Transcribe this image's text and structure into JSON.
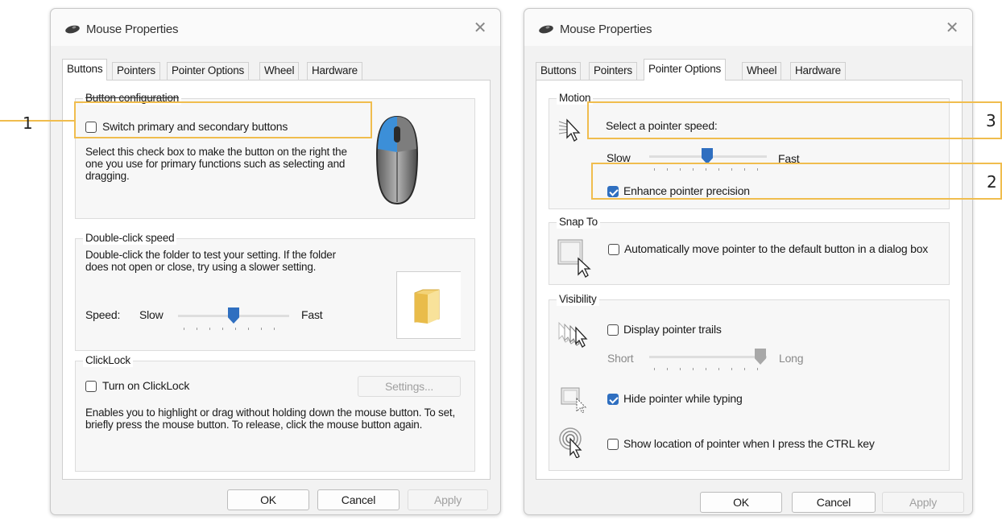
{
  "dialog_a": {
    "title": "Mouse Properties",
    "tabs": [
      "Buttons",
      "Pointers",
      "Pointer Options",
      "Wheel",
      "Hardware"
    ],
    "active_tab": "Buttons",
    "button_config": {
      "title": "Button configuration",
      "checkbox_label": "Switch primary and secondary buttons",
      "checked": false,
      "description": "Select this check box to make the button on the right the one you use for primary functions such as selecting and dragging."
    },
    "double_click": {
      "title": "Double-click speed",
      "description": "Double-click the folder to test your setting. If the folder does not open or close, try using a slower setting.",
      "speed_label": "Speed:",
      "slow_label": "Slow",
      "fast_label": "Fast",
      "slider_value_fraction": 0.5
    },
    "clicklock": {
      "title": "ClickLock",
      "checkbox_label": "Turn on ClickLock",
      "checked": false,
      "settings_label": "Settings...",
      "description": "Enables you to highlight or drag without holding down the mouse button. To set, briefly press the mouse button. To release, click the mouse button again."
    },
    "ok_label": "OK",
    "cancel_label": "Cancel",
    "apply_label": "Apply"
  },
  "dialog_b": {
    "title": "Mouse Properties",
    "tabs": [
      "Buttons",
      "Pointers",
      "Pointer Options",
      "Wheel",
      "Hardware"
    ],
    "active_tab": "Pointer Options",
    "motion": {
      "title": "Motion",
      "speed_label": "Select a pointer speed:",
      "slow_label": "Slow",
      "fast_label": "Fast",
      "slider_value_fraction": 0.5,
      "precision_label": "Enhance pointer precision",
      "precision_checked": true
    },
    "snap_to": {
      "title": "Snap To",
      "checkbox_label": "Automatically move pointer to the default button in a dialog box",
      "checked": false
    },
    "visibility": {
      "title": "Visibility",
      "trails_label": "Display pointer trails",
      "trails_checked": false,
      "short_label": "Short",
      "long_label": "Long",
      "trails_slider_fraction": 1.0,
      "hide_label": "Hide pointer while typing",
      "hide_checked": true,
      "ctrl_label": "Show location of pointer when I press the CTRL key",
      "ctrl_checked": false
    },
    "ok_label": "OK",
    "cancel_label": "Cancel",
    "apply_label": "Apply"
  },
  "callouts": [
    "1",
    "2",
    "3"
  ],
  "colors": {
    "accent": "#2f6fc0",
    "callout": "#f0bd4e"
  }
}
